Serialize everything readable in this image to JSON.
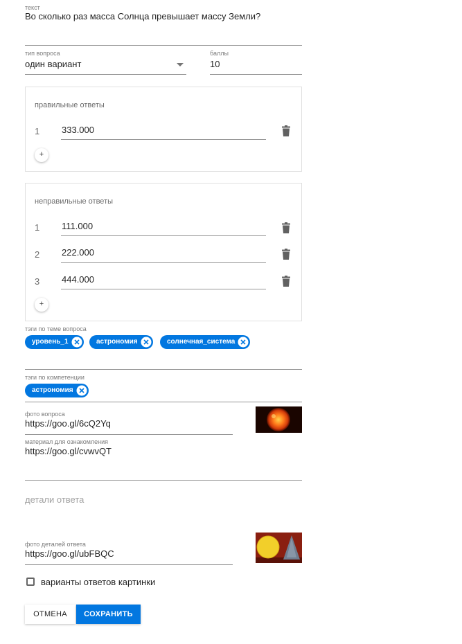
{
  "question": {
    "text_label": "текст",
    "text_value": "Во сколько раз масса Солнца превышает массу Земли?",
    "type_label": "тип вопроса",
    "type_value": "один вариант",
    "points_label": "баллы",
    "points_value": "10"
  },
  "correct_answers": {
    "title": "правильные ответы",
    "items": [
      {
        "index": "1",
        "value": "333.000"
      }
    ],
    "add_label": "+"
  },
  "wrong_answers": {
    "title": "неправильные ответы",
    "items": [
      {
        "index": "1",
        "value": "111.000"
      },
      {
        "index": "2",
        "value": "222.000"
      },
      {
        "index": "3",
        "value": "444.000"
      }
    ],
    "add_label": "+"
  },
  "topic_tags": {
    "label": "тэги по теме вопроса",
    "chips": [
      "уровень_1",
      "астрономия",
      "солнечная_система"
    ]
  },
  "competence_tags": {
    "label": "тэги по компетенции",
    "chips": [
      "астрономия"
    ]
  },
  "photo": {
    "label": "фото вопроса",
    "value": "https://goo.gl/6cQ2Yq"
  },
  "material": {
    "label": "материал для ознакомления",
    "value": "https://goo.gl/cvwvQT"
  },
  "answer_details": {
    "placeholder": "детали ответа"
  },
  "details_photo": {
    "label": "фото деталей ответа",
    "value": "https://goo.gl/ubFBQC"
  },
  "image_answers": {
    "label": "варианты ответов картинки",
    "checked": false
  },
  "actions": {
    "cancel": "ОТМЕНА",
    "save": "СОХРАНИТЬ"
  },
  "colors": {
    "primary": "#0277e0",
    "chip_text": "#ffffff"
  }
}
